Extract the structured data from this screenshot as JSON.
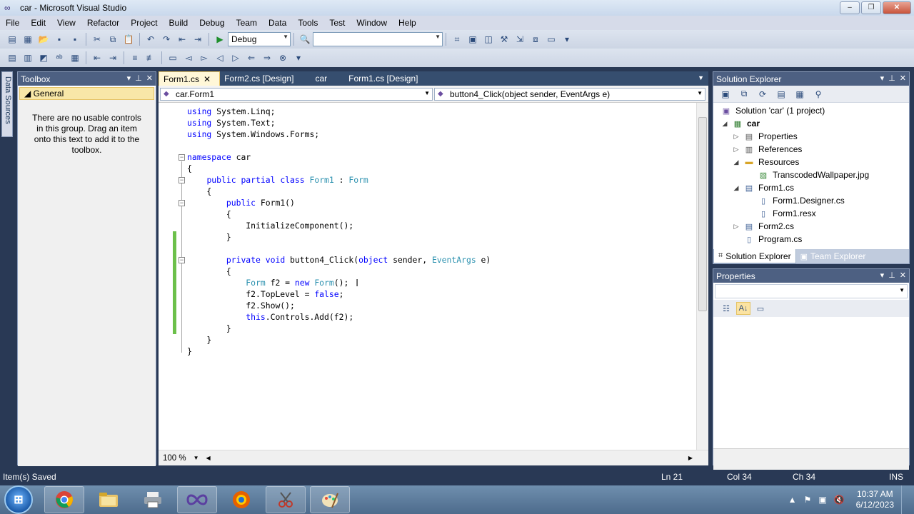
{
  "window": {
    "title": "car - Microsoft Visual Studio",
    "minimize": "‒",
    "maximize": "❐",
    "close": "✕"
  },
  "menu": [
    "File",
    "Edit",
    "View",
    "Refactor",
    "Project",
    "Build",
    "Debug",
    "Team",
    "Data",
    "Tools",
    "Test",
    "Window",
    "Help"
  ],
  "toolbar": {
    "config": "Debug",
    "platform": ""
  },
  "left_tab": {
    "label": "Data Sources"
  },
  "toolbox": {
    "title": "Toolbox",
    "group": "◢ General",
    "message": "There are no usable controls in this group. Drag an item onto this text to add it to the toolbox."
  },
  "editor": {
    "tabs": [
      {
        "label": "Form1.cs",
        "active": true
      },
      {
        "label": "Form2.cs [Design]"
      },
      {
        "label": "car"
      },
      {
        "label": "Form1.cs [Design]"
      }
    ],
    "type_combo": "car.Form1",
    "member_combo": "button4_Click(object sender, EventArgs e)",
    "zoom": "100 %",
    "lines": [
      "using System.Linq;",
      "using System.Text;",
      "using System.Windows.Forms;",
      "",
      "namespace car",
      "{",
      "    public partial class Form1 : Form",
      "    {",
      "        public Form1()",
      "        {",
      "            InitializeComponent();",
      "        }",
      "",
      "        private void button4_Click(object sender, EventArgs e)",
      "        {",
      "            Form f2 = new Form();",
      "            f2.TopLevel = false;",
      "            f2.Show();",
      "            this.Controls.Add(f2);",
      "        }",
      "    }",
      "}"
    ]
  },
  "solution_explorer": {
    "title": "Solution Explorer",
    "items": [
      {
        "label": "Solution 'car' (1 project)",
        "level": 0,
        "expander": "",
        "icon": "solution-icon",
        "bold": false
      },
      {
        "label": "car",
        "level": 0,
        "expander": "◢",
        "icon": "project-icon",
        "bold": true
      },
      {
        "label": "Properties",
        "level": 1,
        "expander": "▷",
        "icon": "properties-icon",
        "bold": false
      },
      {
        "label": "References",
        "level": 1,
        "expander": "▷",
        "icon": "references-icon",
        "bold": false
      },
      {
        "label": "Resources",
        "level": 1,
        "expander": "◢",
        "icon": "folder-icon",
        "bold": false
      },
      {
        "label": "TranscodedWallpaper.jpg",
        "level": 2,
        "expander": "",
        "icon": "image-file-icon",
        "bold": false
      },
      {
        "label": "Form1.cs",
        "level": 1,
        "expander": "◢",
        "icon": "form-icon",
        "bold": false
      },
      {
        "label": "Form1.Designer.cs",
        "level": 2,
        "expander": "",
        "icon": "cs-file-icon",
        "bold": false
      },
      {
        "label": "Form1.resx",
        "level": 2,
        "expander": "",
        "icon": "resx-file-icon",
        "bold": false
      },
      {
        "label": "Form2.cs",
        "level": 1,
        "expander": "▷",
        "icon": "form-icon",
        "bold": false
      },
      {
        "label": "Program.cs",
        "level": 1,
        "expander": "",
        "icon": "cs-file-icon",
        "bold": false
      }
    ],
    "tabs": [
      "Solution Explorer",
      "Team Explorer"
    ]
  },
  "properties": {
    "title": "Properties"
  },
  "status": {
    "message": "Item(s) Saved",
    "ln": "Ln 21",
    "col": "Col 34",
    "ch": "Ch 34",
    "mode": "INS"
  },
  "taskbar": {
    "start": "⊞",
    "apps": [
      "chrome-icon",
      "explorer-folder-icon",
      "printer-icon",
      "visual-studio-icon",
      "firefox-icon",
      "snipping-tool-icon",
      "paint-icon"
    ],
    "time": "10:37 AM",
    "date": "6/12/2023"
  },
  "colors": {
    "keyword": "#0000ff",
    "type": "#2b91af",
    "accent": "#293955"
  }
}
